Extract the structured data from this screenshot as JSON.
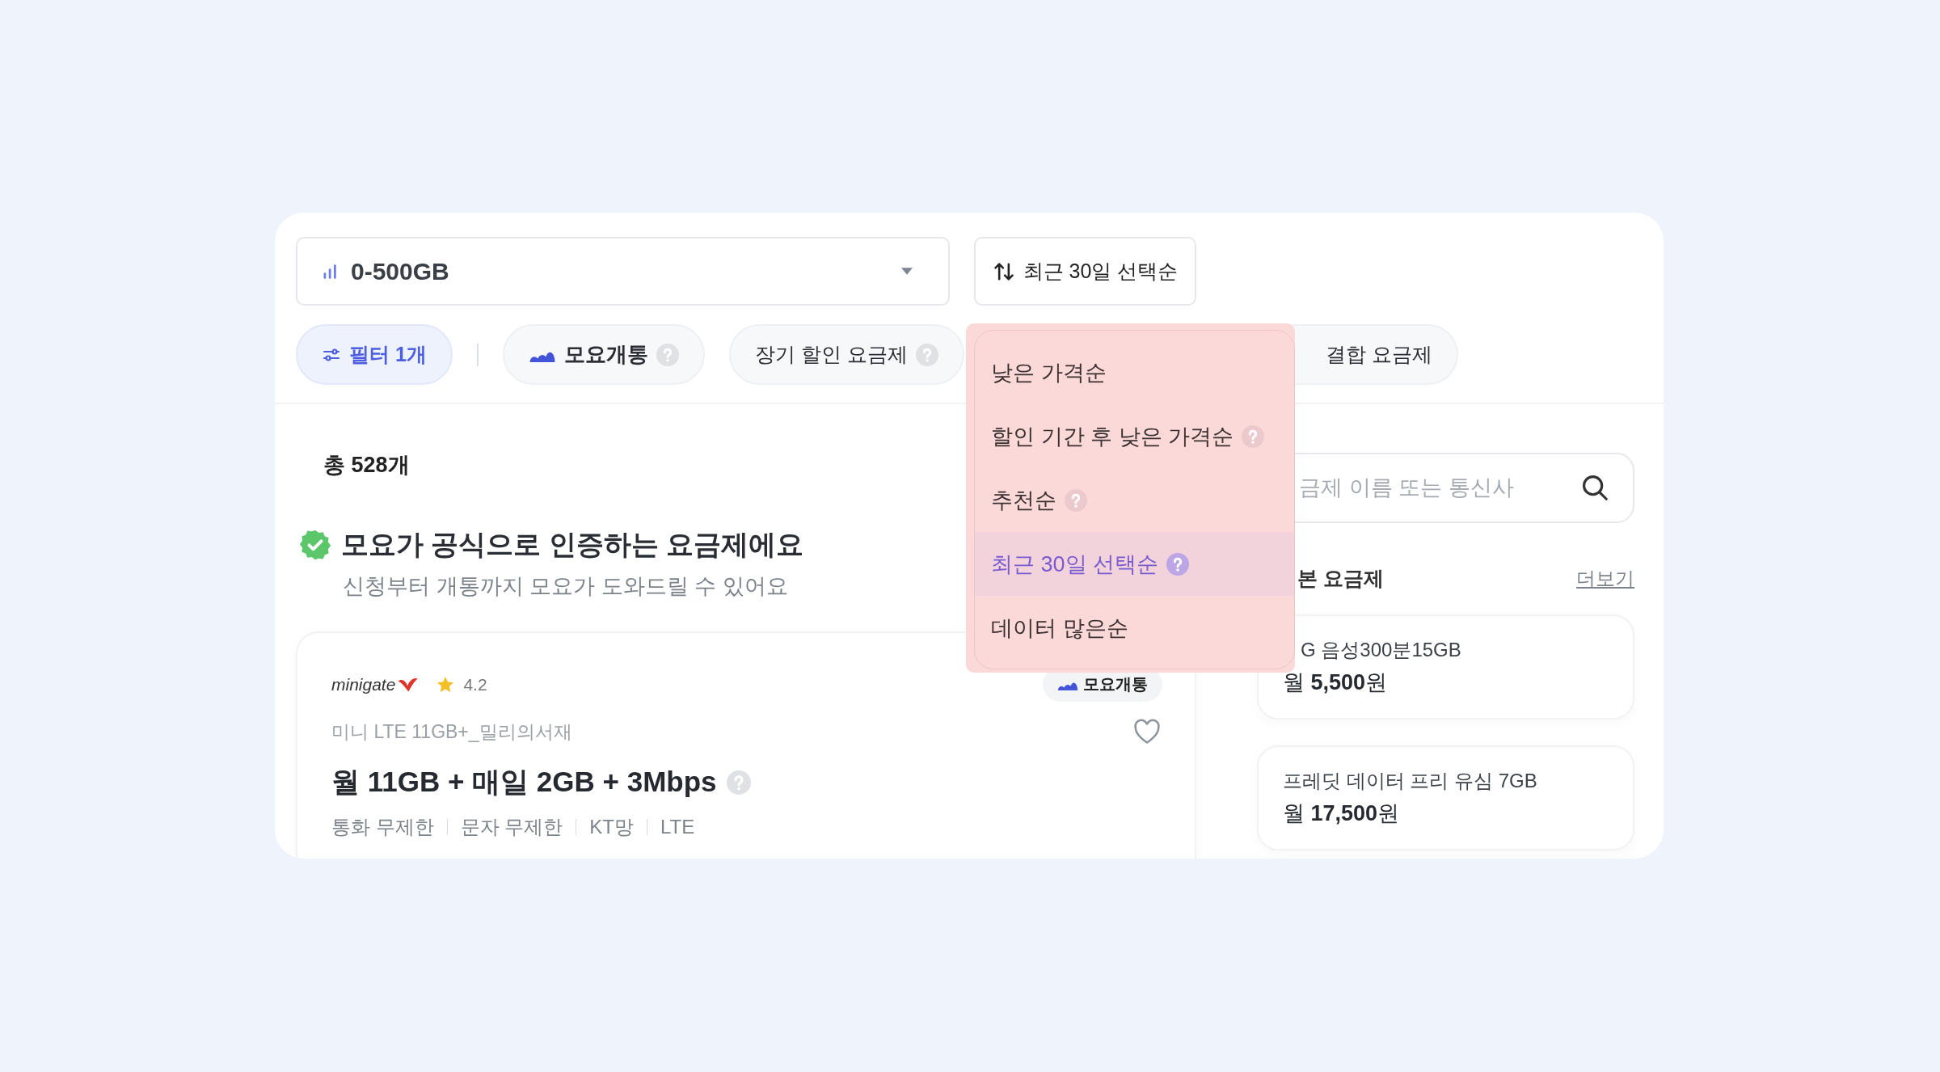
{
  "data_select": {
    "value": "0-500GB"
  },
  "sort_button": {
    "label": "최근 30일 선택순"
  },
  "chips": [
    {
      "kind": "filter",
      "label": "필터 1개",
      "selected": true,
      "help": false
    },
    {
      "kind": "brand",
      "label": "모요개통",
      "selected": false,
      "help": true
    },
    {
      "kind": "plain",
      "label": "장기 할인 요금제",
      "selected": false,
      "help": true
    },
    {
      "kind": "plain",
      "label": "결합 요금제",
      "selected": false,
      "help": false
    }
  ],
  "sort_menu": [
    {
      "label": "낮은 가격순",
      "help": false,
      "selected": false
    },
    {
      "label": "할인 기간 후 낮은 가격순",
      "help": true,
      "selected": false
    },
    {
      "label": "추천순",
      "help": true,
      "selected": false
    },
    {
      "label": "최근 30일 선택순",
      "help": true,
      "selected": true
    },
    {
      "label": "데이터 많은순",
      "help": false,
      "selected": false
    }
  ],
  "total": "총 528개",
  "notice": {
    "title": "모요가 공식으로 인증하는 요금제에요",
    "subtitle": "신청부터 개통까지 모요가 도와드릴 수 있어요"
  },
  "plans": [
    {
      "carrier_logo": "minigate",
      "rating": "4.2",
      "badge": "모요개통",
      "name": "미니 LTE 11GB+_밀리의서재",
      "title": "월 11GB + 매일 2GB + 3Mbps",
      "favorite": false,
      "tags": [
        "통화 무제한",
        "문자 무제한",
        "KT망",
        "LTE"
      ]
    }
  ],
  "search": {
    "placeholder": "금제 이름 또는 통신사"
  },
  "side_section": {
    "title": "본 요금제",
    "more_link": "더보기",
    "items": [
      {
        "name": "G 음성300분15GB",
        "price": "월 **5,500**원"
      },
      {
        "name": "프레딧 데이터 프리 유심 7GB",
        "price": "월 **17,500**원"
      }
    ]
  }
}
